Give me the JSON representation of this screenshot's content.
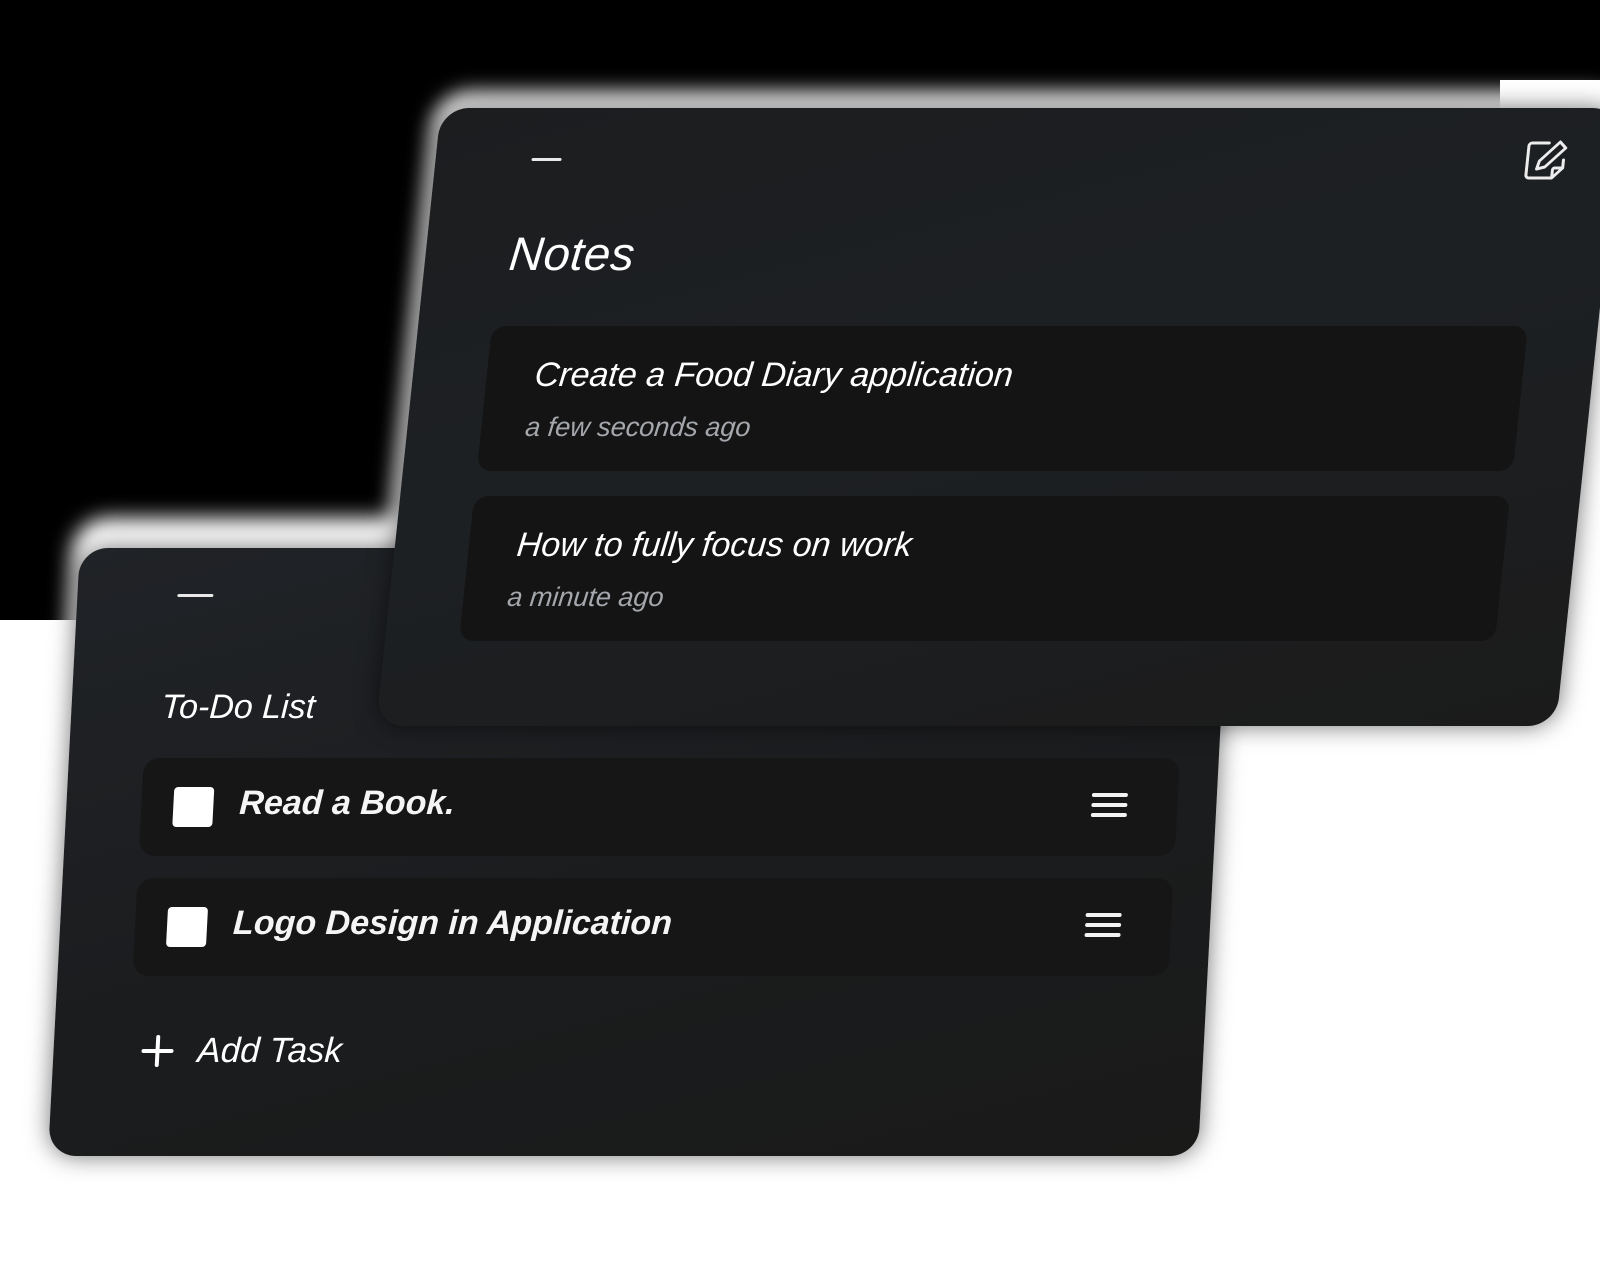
{
  "notes": {
    "title": "Notes",
    "minimize_icon": "minus-icon",
    "new_note_icon": "edit-note-icon",
    "items": [
      {
        "title": "Create a Food Diary application",
        "time": "a few seconds ago"
      },
      {
        "title": "How to fully focus on work",
        "time": "a minute ago"
      }
    ]
  },
  "todo": {
    "title": "To-Do List",
    "minimize_icon": "minus-icon",
    "items": [
      {
        "label": "Read a Book.",
        "checked": false,
        "handle_icon": "drag-handle-icon"
      },
      {
        "label": "Logo Design in Application",
        "checked": false,
        "handle_icon": "drag-handle-icon"
      }
    ],
    "add_task_label": "Add Task",
    "add_icon": "plus-icon"
  },
  "colors": {
    "panel_bg": "#1c1d1f",
    "card_bg": "#141414",
    "text_primary": "#ffffff",
    "text_secondary": "#a4a7ac",
    "backdrop": "#ffffff"
  }
}
